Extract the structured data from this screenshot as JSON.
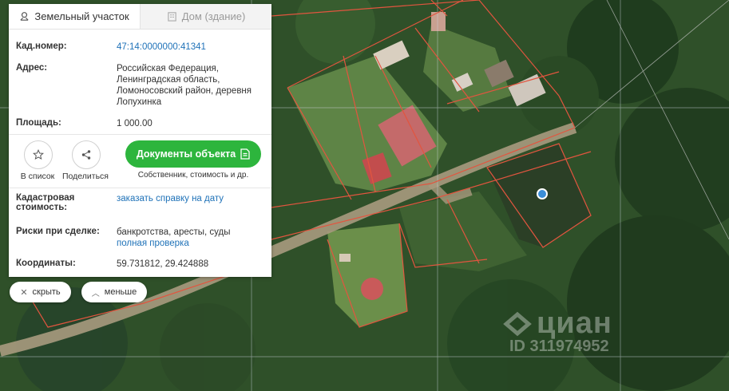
{
  "tabs": {
    "land": "Земельный участок",
    "house": "Дом (здание)"
  },
  "fields": {
    "cadastral_label": "Кад.номер:",
    "cadastral_value": "47:14:0000000:41341",
    "address_label": "Адрес:",
    "address_line1": "Российская Федерация,",
    "address_line2": "Ленинградская область,",
    "address_line3": "Ломоносовский район, деревня",
    "address_line4": "Лопухинка",
    "area_label": "Площадь:",
    "area_value": "1 000.00",
    "cost_label_line1": "Кадастровая",
    "cost_label_line2": "стоимость:",
    "cost_link": "заказать справку на дату",
    "risk_label": "Риски при сделке:",
    "risk_value": "банкротства, аресты, суды",
    "risk_link": "полная проверка",
    "coords_label": "Координаты:",
    "coords_value": "59.731812, 29.424888"
  },
  "actions": {
    "to_list": "В список",
    "share": "Поделиться",
    "documents": "Документы объекта",
    "documents_sub": "Собственник, стоимость и др."
  },
  "controls": {
    "hide": "скрыть",
    "less": "меньше"
  },
  "watermark": {
    "brand": "циан",
    "id": "ID 311974952"
  },
  "colors": {
    "accent_green": "#2db53d",
    "link_blue": "#1f72b8",
    "parcel_border": "#e2553f",
    "marker": "#3a8ed8"
  }
}
